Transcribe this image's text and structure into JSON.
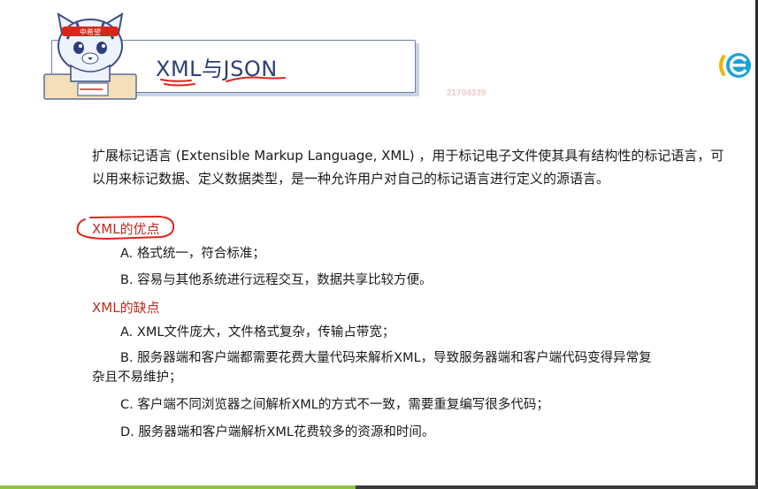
{
  "slide": {
    "title": "XML与JSON",
    "doc_id": "21704339",
    "mascot_headband": "中希望",
    "intro": "扩展标记语言 (Extensible Markup Language, XML) ，用于标记电子文件使其具有结构性的标记语言，可以用来标记数据、定义数据类型，是一种允许用户对自己的标记语言进行定义的源语言。",
    "pros_heading": "XML的优点",
    "pros": [
      "A. 格式统一，符合标准；",
      "B. 容易与其他系统进行远程交互，数据共享比较方便。"
    ],
    "cons_heading": "XML的缺点",
    "cons": [
      "A. XML文件庞大，文件格式复杂，传输占带宽；",
      "B.  服务器端和客户端都需要花费大量代码来解析XML，导致服务器端和客户端代码变得异常复",
      "杂且不易维护；",
      "C. 客户端不同浏览器之间解析XML的方式不一致，需要重复编写很多代码；",
      "D. 服务器端和客户端解析XML花费较多的资源和时间。"
    ]
  },
  "colors": {
    "title": "#2c3f78",
    "heading": "#c0281e",
    "annotation": "#d9261c",
    "progress": "#8dc63f"
  },
  "icons": [
    "cat-mascot-icon",
    "logo-e-icon"
  ]
}
